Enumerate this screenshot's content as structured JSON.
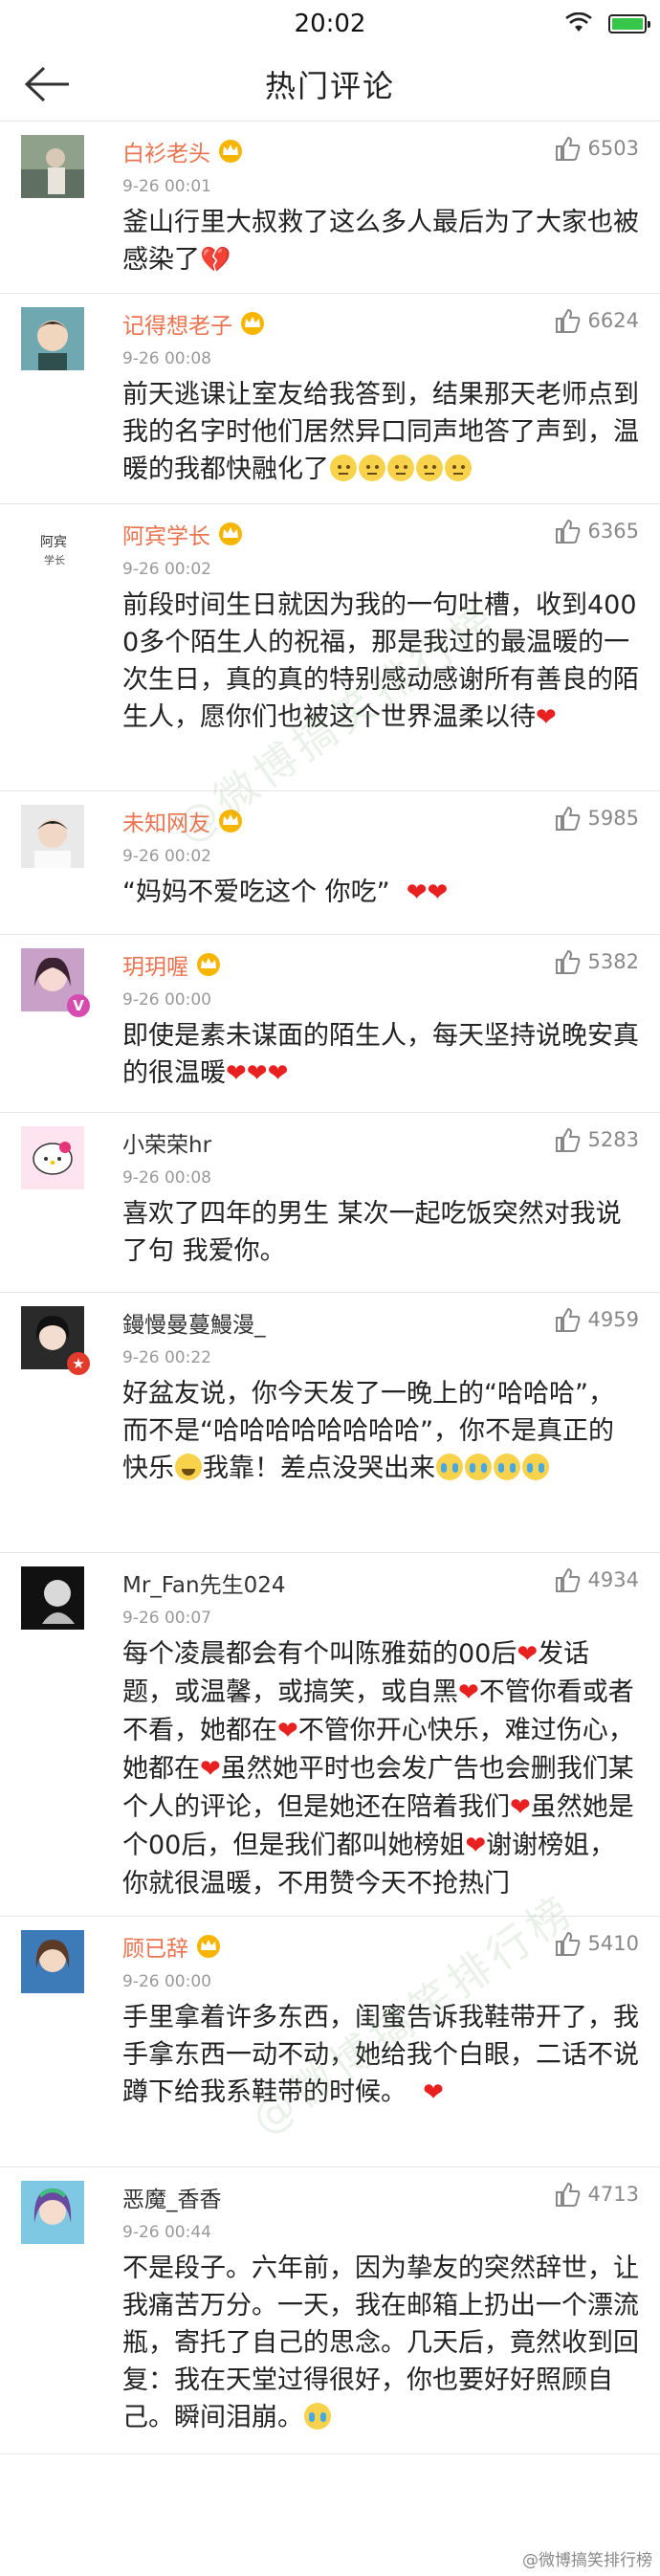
{
  "status_bar": {
    "time": "20:02"
  },
  "header": {
    "title": "热门评论"
  },
  "comments": [
    {
      "name": "白衫老头",
      "time": "9-26 00:01",
      "likes": "6503",
      "text": "釜山行里大叔救了这么多人最后为了大家也被感染了"
    },
    {
      "name": "记得想老子",
      "time": "9-26 00:08",
      "likes": "6624",
      "text": "前天逃课让室友给我答到，结果那天老师点到我的名字时他们居然异口同声地答了声到，温暖的我都快融化了"
    },
    {
      "name": "阿宾学长",
      "time": "9-26 00:02",
      "likes": "6365",
      "avatar_text": "阿宾\n学长",
      "text": "前段时间生日就因为我的一句吐槽，收到4000多个陌生人的祝福，那是我过的最温暖的一次生日，真的真的特别感动感谢所有善良的陌生人，愿你们也被这个世界温柔以待"
    },
    {
      "name": "未知网友",
      "time": "9-26 00:02",
      "likes": "5985",
      "text": "“妈妈不爱吃这个 你吃”"
    },
    {
      "name": "玥玥喔",
      "time": "9-26 00:00",
      "likes": "5382",
      "text": "即使是素未谋面的陌生人，每天坚持说晚安真的很温暖"
    },
    {
      "name": "小荣荣hr",
      "time": "9-26 00:08",
      "likes": "5283",
      "text": "喜欢了四年的男生 某次一起吃饭突然对我说了句 我爱你。"
    },
    {
      "name": "鏝慢曼蔓鰻漫_",
      "time": "9-26 00:22",
      "likes": "4959",
      "text_a": "好盆友说，你今天发了一晚上的“哈哈哈”，而不是“哈哈哈哈哈哈哈哈”，你不是真正的快乐",
      "text_b": "我靠！差点没哭出来"
    },
    {
      "name": "Mr_Fan先生024",
      "time": "9-26 00:07",
      "likes": "4934",
      "text_1": "每个凌晨都会有个叫陈雅茹的00后",
      "text_2": "发话题，或温馨，或搞笑，或自黑",
      "text_3": "不管你看或者不看，她都在",
      "text_4": "不管你开心快乐，难过伤心，她都在",
      "text_5": "虽然她平时也会发广告也会删我们某个人的评论，但是她还在陪着我们",
      "text_6": "虽然她是个00后，但是我们都叫她榜姐",
      "text_7": "谢谢榜姐，你就很温暖，不用赞今天不抢热门"
    },
    {
      "name": "顾已辞",
      "time": "9-26 00:00",
      "likes": "5410",
      "text": "手里拿着许多东西，闺蜜告诉我鞋带开了，我手拿东西一动不动，她给我个白眼，二话不说蹲下给我系鞋带的时候。"
    },
    {
      "name": "恶魔_香香",
      "time": "9-26 00:44",
      "likes": "4713",
      "text": "不是段子。六年前，因为挚友的突然辞世，让我痛苦万分。一天，我在邮箱上扔出一个漂流瓶，寄托了自己的思念。几天后，竟然收到回复：我在天堂过得很好，你也要好好照顾自己。瞬间泪崩。"
    }
  ],
  "watermark": {
    "corner": "@微博搞笑排行榜",
    "diagonal": "@微博搞笑排行榜"
  },
  "colors": {
    "name_orange": "#eb7350",
    "heart_red": "#e8201f",
    "divider": "#e6e6e6"
  },
  "icons": {
    "like": "thumb-up-icon",
    "crown": "crown-icon",
    "back": "back-arrow-icon"
  }
}
